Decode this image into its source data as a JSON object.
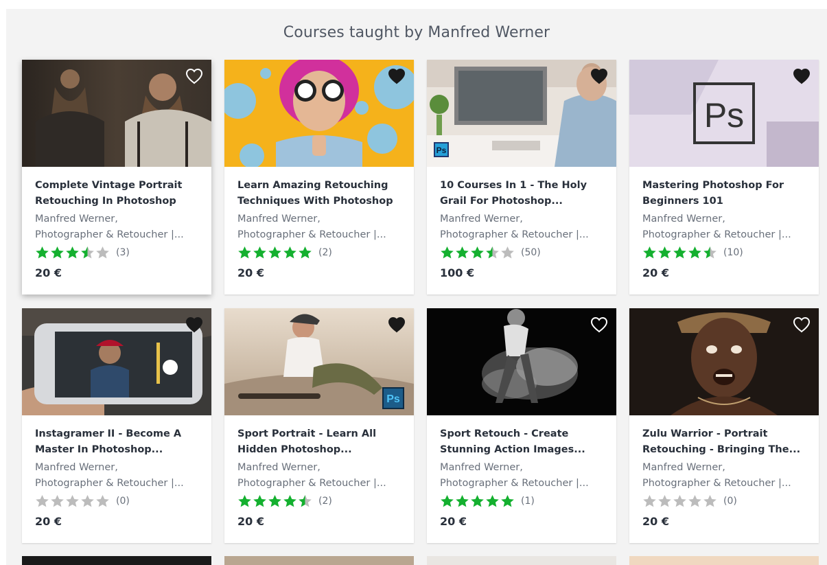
{
  "section": {
    "title": "Courses taught by Manfred Werner"
  },
  "colors": {
    "star_filled": "#14b02f",
    "star_empty": "#bcbcbc",
    "heart": "#1a1a1a"
  },
  "courses": [
    {
      "title_line1": "Complete Vintage Portrait",
      "title_line2": "Retouching In Photoshop",
      "instructor_name": "Manfred Werner,",
      "instructor_role": "Photographer & Retoucher |...",
      "rating": 3.5,
      "rating_count": "(3)",
      "price": "20 €",
      "wishlisted": false
    },
    {
      "title_line1": "Learn Amazing Retouching",
      "title_line2": "Techniques With Photoshop",
      "instructor_name": "Manfred Werner,",
      "instructor_role": "Photographer & Retoucher |...",
      "rating": 5,
      "rating_count": "(2)",
      "price": "20 €",
      "wishlisted": true
    },
    {
      "title_line1": "10 Courses In 1 - The Holy",
      "title_line2": "Grail For Photoshop...",
      "instructor_name": "Manfred Werner,",
      "instructor_role": "Photographer & Retoucher |...",
      "rating": 3.5,
      "rating_count": "(50)",
      "price": "100 €",
      "wishlisted": true
    },
    {
      "title_line1": "Mastering Photoshop For",
      "title_line2": "Beginners 101",
      "instructor_name": "Manfred Werner,",
      "instructor_role": "Photographer & Retoucher |...",
      "rating": 4.5,
      "rating_count": "(10)",
      "price": "20 €",
      "wishlisted": true,
      "ps_text": "Ps"
    },
    {
      "title_line1": "Instagramer II - Become A",
      "title_line2": "Master In Photoshop...",
      "instructor_name": "Manfred Werner,",
      "instructor_role": "Photographer & Retoucher |...",
      "rating": 0,
      "rating_count": "(0)",
      "price": "20 €",
      "wishlisted": true
    },
    {
      "title_line1": "Sport Portrait - Learn All",
      "title_line2": "Hidden Photoshop...",
      "instructor_name": "Manfred Werner,",
      "instructor_role": "Photographer & Retoucher |...",
      "rating": 4.5,
      "rating_count": "(2)",
      "price": "20 €",
      "wishlisted": true,
      "ps_text": "Ps"
    },
    {
      "title_line1": "Sport Retouch - Create",
      "title_line2": "Stunning Action Images...",
      "instructor_name": "Manfred Werner,",
      "instructor_role": "Photographer & Retoucher |...",
      "rating": 5,
      "rating_count": "(1)",
      "price": "20 €",
      "wishlisted": false
    },
    {
      "title_line1": "Zulu Warrior - Portrait",
      "title_line2": "Retouching - Bringing The...",
      "instructor_name": "Manfred Werner,",
      "instructor_role": "Photographer & Retoucher |...",
      "rating": 0,
      "rating_count": "(0)",
      "price": "20 €",
      "wishlisted": false
    }
  ]
}
